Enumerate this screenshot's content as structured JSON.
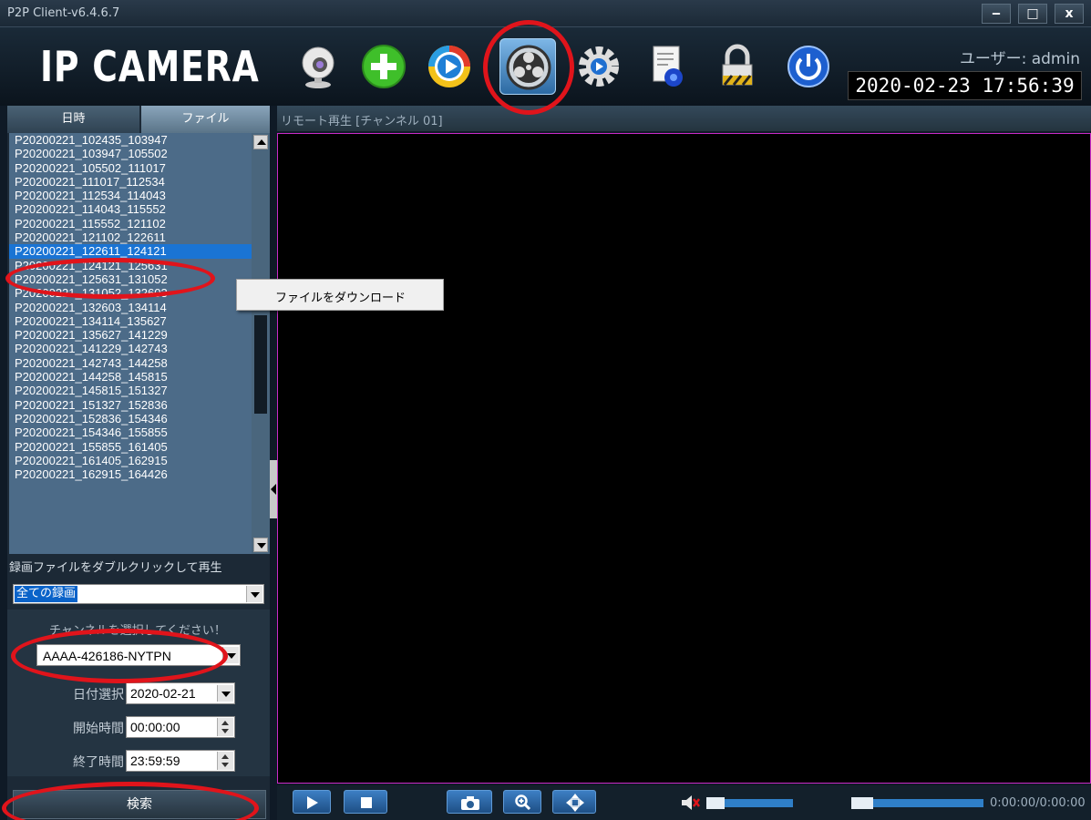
{
  "window": {
    "title": "P2P Client-v6.4.6.7",
    "controls": {
      "minimize": "‒",
      "maximize": "□",
      "close": "x"
    }
  },
  "header": {
    "logo_text": "IP CAMERA",
    "user_label": "ユーザー: admin",
    "datetime": "2020-02-23 17:56:39",
    "toolbar_icons": [
      "webcam-icon",
      "add-plus-icon",
      "play-record-icon",
      "film-reel-icon",
      "gear-play-icon",
      "document-gear-icon",
      "padlock-icon",
      "power-icon"
    ],
    "active_toolbar_icon": "film-reel-icon"
  },
  "left_panel": {
    "tabs": [
      "日時",
      "ファイル"
    ],
    "active_tab": "ファイル",
    "files": [
      "P20200221_102435_103947",
      "P20200221_103947_105502",
      "P20200221_105502_111017",
      "P20200221_111017_112534",
      "P20200221_112534_114043",
      "P20200221_114043_115552",
      "P20200221_115552_121102",
      "P20200221_121102_122611",
      "P20200221_122611_124121",
      "P20200221_124121_125631",
      "P20200221_125631_131052",
      "P20200221_131052_132603",
      "P20200221_132603_134114",
      "P20200221_134114_135627",
      "P20200221_135627_141229",
      "P20200221_141229_142743",
      "P20200221_142743_144258",
      "P20200221_144258_145815",
      "P20200221_145815_151327",
      "P20200221_151327_152836",
      "P20200221_152836_154346",
      "P20200221_154346_155855",
      "P20200221_155855_161405",
      "P20200221_161405_162915",
      "P20200221_162915_164426"
    ],
    "selected_file": "P20200221_122611_124121",
    "hint": "録画ファイルをダブルクリックして再生",
    "record_type": "全ての録画",
    "channel_prompt": "チャンネルを選択してください！",
    "channel": "AAAA-426186-NYTPN",
    "date_label": "日付選択",
    "date_value": "2020-02-21",
    "start_label": "開始時間",
    "start_value": "00:00:00",
    "end_label": "終了時間",
    "end_value": "23:59:59",
    "search_button": "検索"
  },
  "video": {
    "header": "リモート再生 [チャンネル 01]",
    "border_color": "#c92ac7"
  },
  "playback": {
    "time": "0:00:00/0:00:00",
    "volume_muted": true
  },
  "context_menu": {
    "items": [
      "ファイルをダウンロード"
    ]
  },
  "annotation_color": "#e0141b"
}
